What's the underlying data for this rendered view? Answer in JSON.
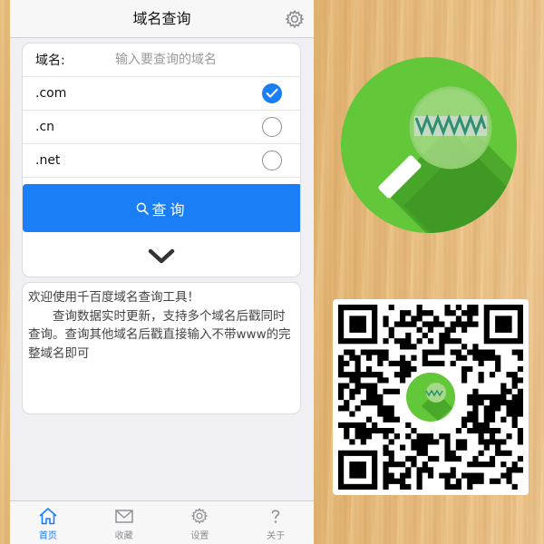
{
  "app": {
    "title": "域名查询",
    "icons": {
      "settings": "gear-icon"
    }
  },
  "form": {
    "domain_label": "域名:",
    "domain_value": "",
    "domain_placeholder": "输入要查询的域名",
    "options": [
      {
        "label": ".com",
        "checked": true
      },
      {
        "label": ".cn",
        "checked": false
      },
      {
        "label": ".net",
        "checked": false
      }
    ],
    "search_label": "查询",
    "expand_icon": "chevron-down-icon"
  },
  "info": {
    "line1": "欢迎使用千百度域名查询工具！",
    "line2": "查询数据实时更新，支持多个域名后戳同时查询。查询其他域名后戳直接输入不带www的完整域名即可"
  },
  "tabs": [
    {
      "label": "首页",
      "icon": "home-icon",
      "active": true
    },
    {
      "label": "收藏",
      "icon": "envelope-icon",
      "active": false
    },
    {
      "label": "设置",
      "icon": "gear-icon",
      "active": false
    },
    {
      "label": "关于",
      "icon": "help-icon",
      "active": false
    }
  ],
  "colors": {
    "accent": "#1a7ef7",
    "logo_green": "#62c83a",
    "logo_shadow": "#3f9a24",
    "wood": "#ebc083"
  }
}
